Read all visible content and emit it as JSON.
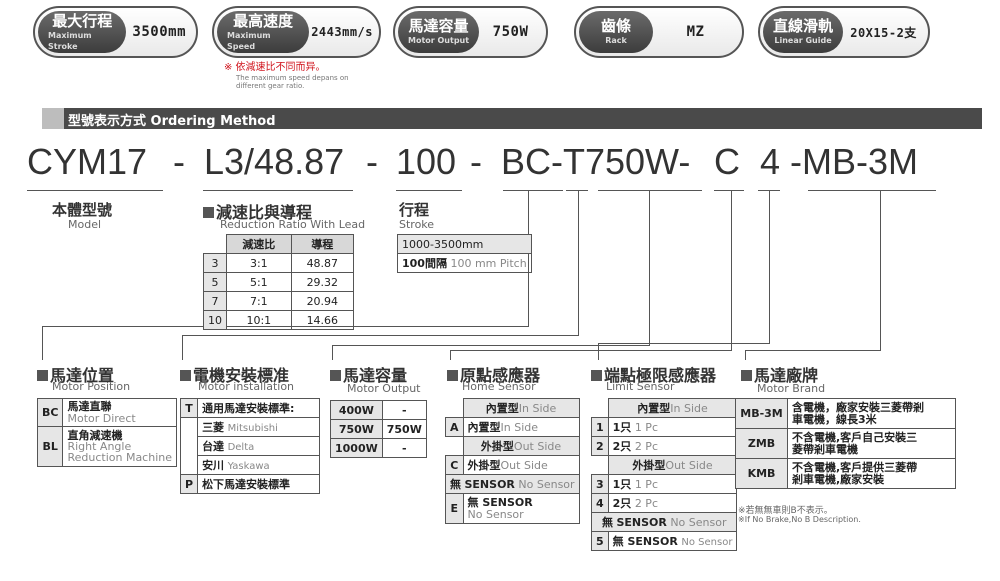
{
  "pills": [
    {
      "zh": "最大行程",
      "en": "Maximum Stroke",
      "value": "3500mm"
    },
    {
      "zh": "最高速度",
      "en": "Maximum Speed",
      "value": "2443mm/s"
    },
    {
      "zh": "馬達容量",
      "en": "Motor Output",
      "value": "750W"
    },
    {
      "zh": "齒條",
      "en": "Rack",
      "value": "MZ"
    },
    {
      "zh": "直線滑軌",
      "en": "Linear Guide",
      "value": "20X15-2支"
    }
  ],
  "note": {
    "zh": "※ 依減速比不同而异。",
    "en1": "The maximum speed depans on",
    "en2": "different gear ratio."
  },
  "header": "型號表示方式  Ordering Method",
  "code": {
    "p1": "CYM17",
    "d1": "-",
    "p2": "L3/48.87",
    "d2": "-",
    "p3": "100",
    "d3": "-",
    "p4": "BC-T750W-",
    "p5": "C",
    "p6": "4",
    "p7": "-MB-3M"
  },
  "model": {
    "zh": "本體型號",
    "en": "Model"
  },
  "ratio": {
    "zh": "減速比與導程",
    "en": "Reduction Ratio With  Lead",
    "h1": "減速比",
    "h2": "導程",
    "rows": [
      [
        "3",
        "3:1",
        "48.87"
      ],
      [
        "5",
        "5:1",
        "29.32"
      ],
      [
        "7",
        "7:1",
        "20.94"
      ],
      [
        "10",
        "10:1",
        "14.66"
      ]
    ]
  },
  "stroke": {
    "zh": "行程",
    "en": "Stroke",
    "r1": "1000-3500mm",
    "r2a": "100間隔",
    "r2b": "100 mm Pitch"
  },
  "motor_pos": {
    "zh": "馬達位置",
    "en": "Motor Position",
    "rows": [
      {
        "code": "BC",
        "zh": "馬達直聯",
        "en": "Motor Direct"
      },
      {
        "code": "BL",
        "zh": "直角減速機",
        "en": "Right Angle",
        "en2": "Reduction Machine"
      }
    ]
  },
  "install": {
    "zh": "電機安裝標准",
    "en": "Motor installation",
    "rows": [
      {
        "code": "T",
        "zh": "通用馬達安裝標準:",
        "en": ""
      },
      {
        "code": "",
        "zh": "三菱",
        "en": "Mitsubishi"
      },
      {
        "code": "",
        "zh": "台達",
        "en": "Delta"
      },
      {
        "code": "",
        "zh": "安川",
        "en": "Yaskawa"
      },
      {
        "code": "P",
        "zh": "松下馬達安裝標準",
        "en": ""
      }
    ]
  },
  "output": {
    "zh": "馬達容量",
    "en": "Motor Output",
    "rows": [
      [
        "400W",
        "-"
      ],
      [
        "750W",
        "750W"
      ],
      [
        "1000W",
        "-"
      ]
    ]
  },
  "home": {
    "zh": "原點感應器",
    "en": "Home Sensor",
    "rows": [
      {
        "code": "",
        "zh": "內置型",
        "en": "In Side"
      },
      {
        "code": "A",
        "zh": "內置型",
        "en": "In Side"
      },
      {
        "code": "",
        "zh": "外掛型",
        "en": "Out Side"
      },
      {
        "code": "C",
        "zh": "外掛型",
        "en": "Out Side"
      },
      {
        "code": "無",
        "zh": "SENSOR",
        "en": "No Sensor"
      },
      {
        "code": "E",
        "zh": "無  SENSOR",
        "en": "No Sensor"
      }
    ]
  },
  "limit": {
    "zh": "端點極限感應器",
    "en": "Limit Sensor",
    "rows": [
      {
        "code": "",
        "zh": "內置型",
        "en": "In Side"
      },
      {
        "code": "1",
        "zh": "1只",
        "en": "1 Pc"
      },
      {
        "code": "2",
        "zh": "2只",
        "en": "2 Pc"
      },
      {
        "code": "",
        "zh": "外掛型",
        "en": "Out Side"
      },
      {
        "code": "3",
        "zh": "1只",
        "en": "1 Pc"
      },
      {
        "code": "4",
        "zh": "2只",
        "en": "2 Pc"
      },
      {
        "code": "無",
        "zh": "SENSOR",
        "en": "No Sensor"
      },
      {
        "code": "5",
        "zh": "無  SENSOR",
        "en": "No Sensor"
      }
    ]
  },
  "brand": {
    "zh": "馬達廠牌",
    "en": "Motor Brand",
    "rows": [
      {
        "code": "MB-3M",
        "desc1": "含電機，廠家安裝三菱帶剎",
        "desc2": "車電機，線長3米"
      },
      {
        "code": "ZMB",
        "desc1": "不含電機,客戶自己安裝三",
        "desc2": "菱帶剎車電機"
      },
      {
        "code": "KMB",
        "desc1": "不含電機,客戶提供三菱帶",
        "desc2": "剎車電機,廠家安裝"
      }
    ],
    "note1": "※若無無車則B不表示。",
    "note2": "※If No Brake,No B Description."
  }
}
